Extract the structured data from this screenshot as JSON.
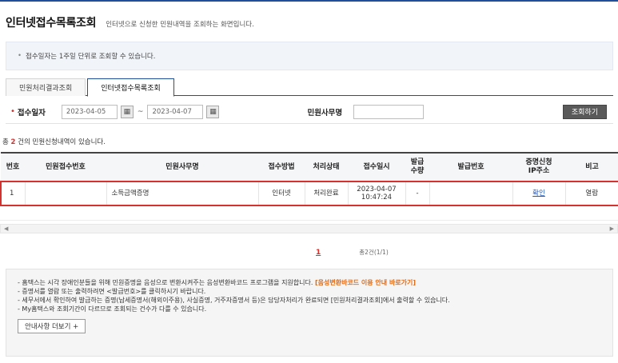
{
  "header": {
    "title": "인터넷접수목록조회",
    "description": "인터넷으로 신청한 민원내역을 조회하는 화면입니다."
  },
  "notice_top": {
    "text": "접수일자는 1주일 단위로 조회할 수 있습니다."
  },
  "tabs": [
    {
      "label": "민원처리결과조회",
      "active": false
    },
    {
      "label": "인터넷접수목록조회",
      "active": true
    }
  ],
  "search": {
    "date_label": "접수일자",
    "date_from": "2023-04-05",
    "date_to": "2023-04-07",
    "tilde": "~",
    "name_label": "민원사무명",
    "name_value": "",
    "button_label": "조회하기"
  },
  "result": {
    "prefix": "총 ",
    "count": "2",
    "suffix": " 건의 민원신청내역이 있습니다."
  },
  "table": {
    "columns": [
      "번호",
      "민원접수번호",
      "민원사무명",
      "접수방법",
      "처리상태",
      "접수일시",
      "발급\n수량",
      "발급번호",
      "증명신청\nIP주소",
      "비고"
    ],
    "rows": [
      {
        "no": "1",
        "receipt_no": "",
        "service_name": "소득금액증명",
        "method": "인터넷",
        "status": "처리완료",
        "date": "2023-04-07",
        "time": "10:47:24",
        "qty": "-",
        "issue_no": "",
        "ip_link": "확인",
        "note": "열람"
      }
    ]
  },
  "scroll": {
    "left": "◀",
    "right": "▶"
  },
  "pager": {
    "current": "1",
    "total": "총2건(1/1)"
  },
  "info": {
    "line1_text": "- 홈택스는 시각 장애인분들을 위해 민원증명을 음성으로 변환시켜주는 음성변환바코드 프로그램을 지원합니다.",
    "line1_link": "[음성변환바코드 이용 안내 바로가기]",
    "line2": "- 증명서를 열람 또는 출력하려면 <발급번호>를 클릭하시기 바랍니다.",
    "line3": "- 세무서에서 확인하여 발급하는 증명(납세증명서(해외이주용), 사실증명, 거주자증명서 등)은 담당자처리가 완료되면 [민원처리결과조회]에서 출력할 수 있습니다.",
    "line4": "- My홈택스와 조회기간이 다르므로 조회되는 건수가 다를 수 있습니다.",
    "more_button": "안내사항 더보기 +"
  },
  "colors": {
    "accent_blue": "#1f4e9c",
    "highlight_red": "#d4322e",
    "link_orange": "#e06b18"
  }
}
